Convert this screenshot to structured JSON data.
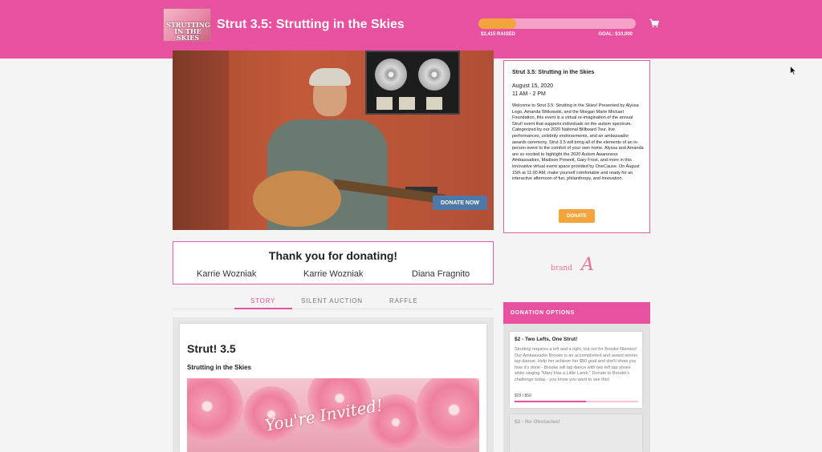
{
  "header": {
    "logo_text": "STRUTTING IN THE SKIES",
    "event_title": "Strut 3.5: Strutting in the Skies",
    "raised_label": "$2,415 RAISED",
    "goal_label": "GOAL: $10,000",
    "progress_fraction": 0.2415,
    "accent_color": "#e8519f"
  },
  "video": {
    "donate_now_label": "DONATE NOW"
  },
  "thanks": {
    "heading": "Thank you for donating!",
    "donors": [
      "Karrie Wozniak",
      "Karrie Wozniak",
      "Diana Fragnito"
    ]
  },
  "tabs": [
    {
      "label": "STORY",
      "active": true
    },
    {
      "label": "SILENT AUCTION",
      "active": false
    },
    {
      "label": "RAFFLE",
      "active": false
    }
  ],
  "story": {
    "title": "Strut! 3.5",
    "subtitle": "Strutting in the Skies",
    "invite_text": "You're Invited!"
  },
  "info": {
    "title": "Strut 3.5: Strutting in the Skies",
    "date": "August 15, 2020",
    "time": "11 AM - 2 PM",
    "description": "Welcome to Strut 3.5: Strutting in the Skies! Presented by Alyssa Lego, Amanda Witkowski, and the Morgan Marie Michael Foundation, this event is a virtual re-imagination of the annual Strut! event that supports individuals on the autism spectrum. Categorized by our 2020 National Billboard Tour, live performances, celebrity endorsements, and an ambassador awards ceremony, Strut 3.5 will bring all of the elements of an in-person event to the comfort of your own home. Alyssa and Amanda are so excited to highlight the 2020 Autism Awareness Ambassadors, Madison Prewett, Gary Frost, and more in this innovative virtual event space provided by OneCause. On August 15th at 11:00 AM, make yourself comfortable and ready for an interactive afternoon of fun, philanthropy, and innovation.",
    "donate_label": "DONATE"
  },
  "brand": {
    "text": "brand",
    "mark": "A"
  },
  "donation_options": {
    "heading": "DONATION OPTIONS",
    "options": [
      {
        "title": "$2 - Two Lefts, One Strut!",
        "description": "Strutting requires a left and a right, but not for Brooke Niemiec! Our Ambassador Brooke is an accomplished and award winner tap dancer. Help her achieve her $50 goal and she'll show you how it's done - Brooke will tap dance with two left tap shoes while singing \"Mary Has a Little Lamb.\" Donate to Brooke's challenge today - you know you want to see this!",
        "progress_label": "$29 / $50",
        "progress_fraction": 0.58
      },
      {
        "title": "$2 - No Obstacles!"
      }
    ]
  }
}
